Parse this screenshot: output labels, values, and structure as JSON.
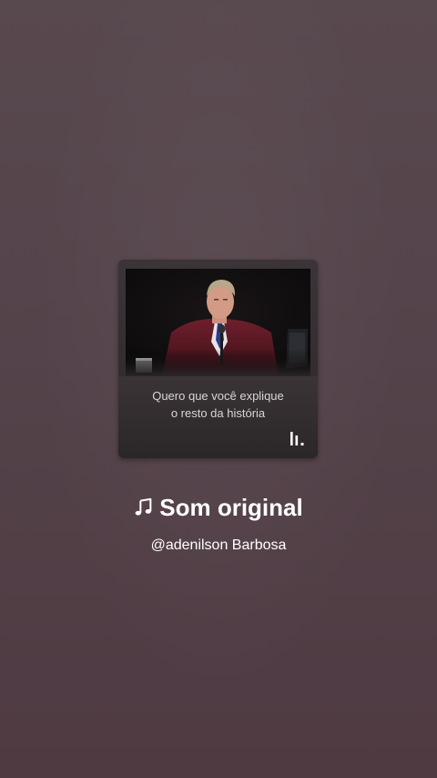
{
  "cover": {
    "caption_line1": "Quero que você explique",
    "caption_line2": "o resto da história",
    "logo_icon": "bars-logo-icon"
  },
  "audio": {
    "icon": "music-note-icon",
    "title": "Som original",
    "author": "@adenilson Barbosa"
  },
  "colors": {
    "background": "#54434a",
    "text": "#ffffff",
    "caption_text": "#d9d6d8"
  }
}
